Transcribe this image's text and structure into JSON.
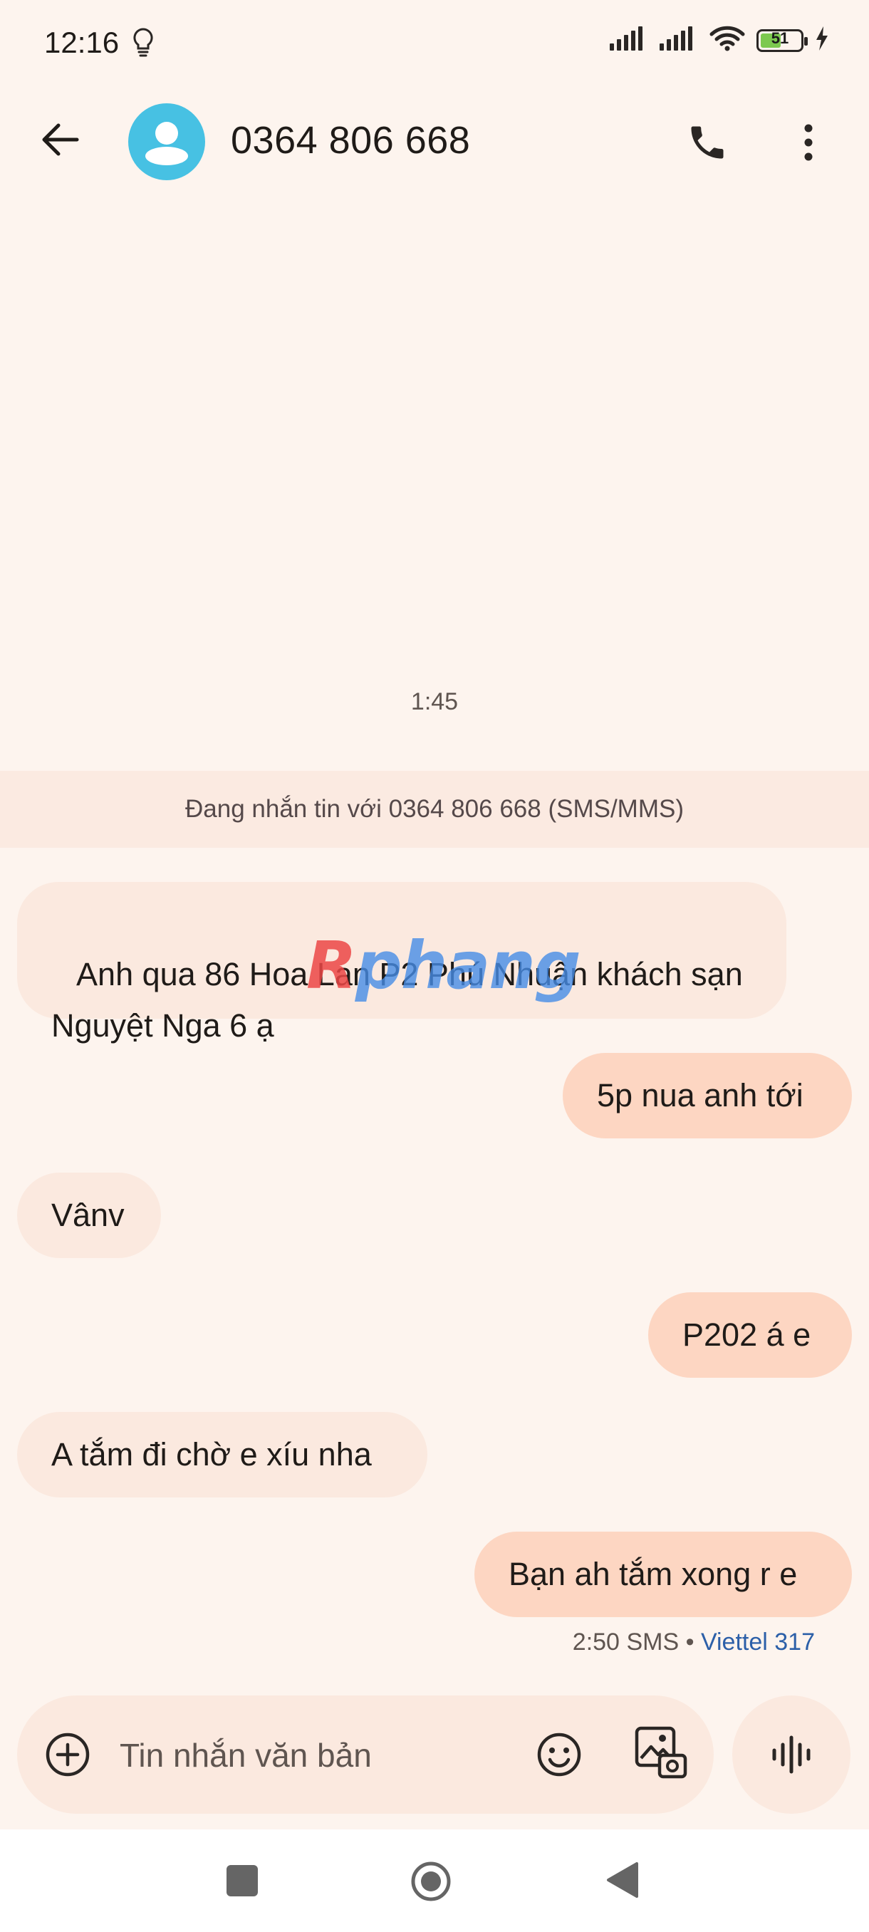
{
  "status_bar": {
    "time": "12:16",
    "battery_level": "51",
    "battery_fraction": 0.51,
    "icons": [
      "lightbulb-icon",
      "signal-icon",
      "signal-icon",
      "wifi-icon",
      "battery-icon",
      "charging-icon"
    ]
  },
  "header": {
    "contact": "0364 806 668",
    "icons": [
      "back-arrow-icon",
      "avatar-person-icon",
      "phone-icon",
      "more-vert-icon"
    ]
  },
  "conversation": {
    "time_separator": "1:45",
    "info_banner": "Đang nhắn tin với 0364 806 668 (SMS/MMS)",
    "messages": [
      {
        "direction": "incoming",
        "text": " Anh qua 86 Hoa Lan P2 Phú Nhuận khách sạn Nguyệt Nga 6 ạ"
      },
      {
        "direction": "outgoing",
        "text": "5p nua anh tới"
      },
      {
        "direction": "incoming",
        "text": "Vânv"
      },
      {
        "direction": "outgoing",
        "text": "P202 á e"
      },
      {
        "direction": "incoming",
        "text": "A tắm đi chờ e xíu nha"
      },
      {
        "direction": "outgoing",
        "text": "Bạn ah tắm xong r e"
      }
    ],
    "last_meta": {
      "time": "2:50",
      "type": "SMS",
      "separator": "•",
      "carrier": "Viettel 317"
    }
  },
  "watermark": {
    "first": "R",
    "rest": "phang"
  },
  "composer": {
    "placeholder": "Tin nhắn văn bản",
    "value": "",
    "icons": [
      "add-circle-icon",
      "emoji-icon",
      "gallery-icon",
      "voice-icon"
    ]
  },
  "nav_bar": {
    "icons": [
      "recents-square-icon",
      "home-circle-icon",
      "back-triangle-icon"
    ]
  },
  "colors": {
    "background": "#fdf4ee",
    "incoming_bubble": "#fbe9df",
    "outgoing_bubble": "#fdd6c2",
    "avatar": "#47c1e3",
    "carrier_link": "#2c5fa8",
    "battery_fill": "#7cc94f"
  }
}
